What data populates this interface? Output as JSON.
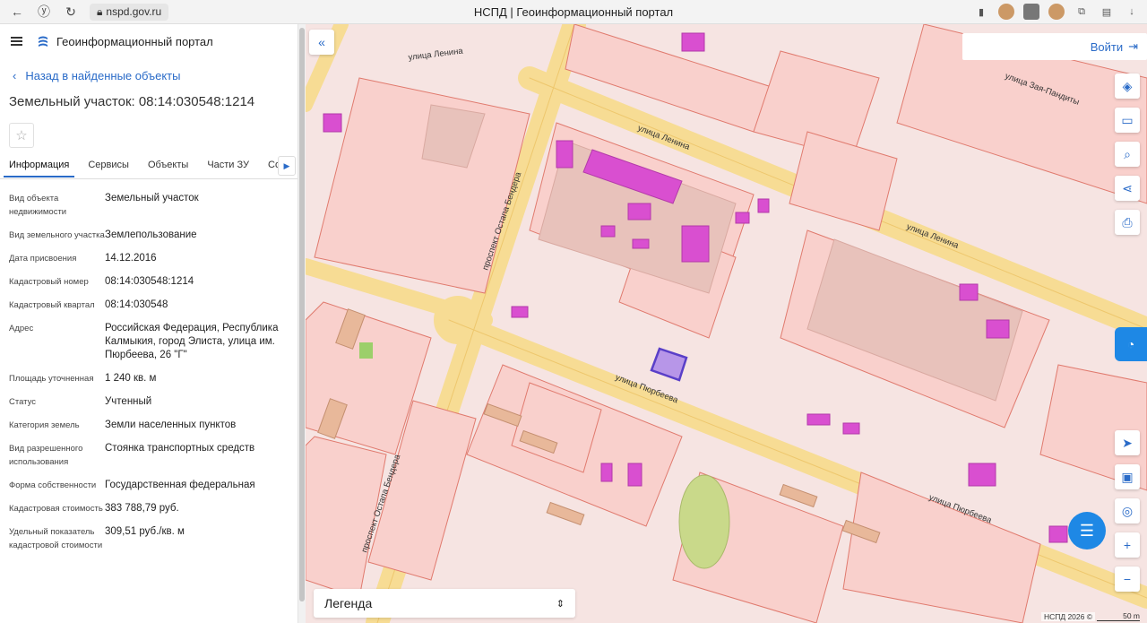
{
  "browser": {
    "url": "nspd.gov.ru",
    "title": "НСПД | Геоинформационный портал"
  },
  "app": {
    "name": "Геоинформационный портал",
    "back_label": "Назад в найденные объекты",
    "object_title": "Земельный участок: 08:14:030548:1214"
  },
  "tabs": [
    "Информация",
    "Сервисы",
    "Объекты",
    "Части ЗУ",
    "Соста"
  ],
  "properties": [
    {
      "key": "Вид объекта недвижимости",
      "value": "Земельный участок"
    },
    {
      "key": "Вид земельного участка",
      "value": "Землепользование"
    },
    {
      "key": "Дата присвоения",
      "value": "14.12.2016"
    },
    {
      "key": "Кадастровый номер",
      "value": "08:14:030548:1214"
    },
    {
      "key": "Кадастровый квартал",
      "value": "08:14:030548"
    },
    {
      "key": "Адрес",
      "value": "Российская Федерация, Республика Калмыкия, город Элиста, улица им. Пюрбеева, 26 \"Г\""
    },
    {
      "key": "Площадь уточненная",
      "value": "1 240 кв. м"
    },
    {
      "key": "Статус",
      "value": "Учтенный"
    },
    {
      "key": "Категория земель",
      "value": "Земли населенных пунктов"
    },
    {
      "key": "Вид разрешенного использования",
      "value": "Стоянка транспортных средств"
    },
    {
      "key": "Форма собственности",
      "value": "Государственная федеральная"
    },
    {
      "key": "Кадастровая стоимость",
      "value": "383 788,79 руб."
    },
    {
      "key": "Удельный показатель кадастровой стоимости",
      "value": "309,51 руб./кв. м"
    }
  ],
  "map": {
    "login_label": "Войти",
    "legend_label": "Легенда",
    "copyright": "НСПД 2026 ©",
    "scale": "50 m",
    "streets": {
      "lenina_1": "улица Ленина",
      "lenina_2": "улица Ленина",
      "lenina_3": "улица Ленина",
      "zaya_pandity": "улица Зая-Пандиты",
      "purbeeva_1": "улица Пюрбеева",
      "purbeeva_2": "улица Пюрбеева",
      "bendera_1": "проспект Остапа Бендера",
      "bendera_2": "проспект Остапа Бендера"
    },
    "colors": {
      "parcel_fill": "#f9d0cc",
      "parcel_line": "#e07a6e",
      "building": "#d94fd0",
      "road": "#f7dc94",
      "selected": "#5a3fc8",
      "park": "#c9d98a",
      "accent": "#1e88e5"
    }
  }
}
